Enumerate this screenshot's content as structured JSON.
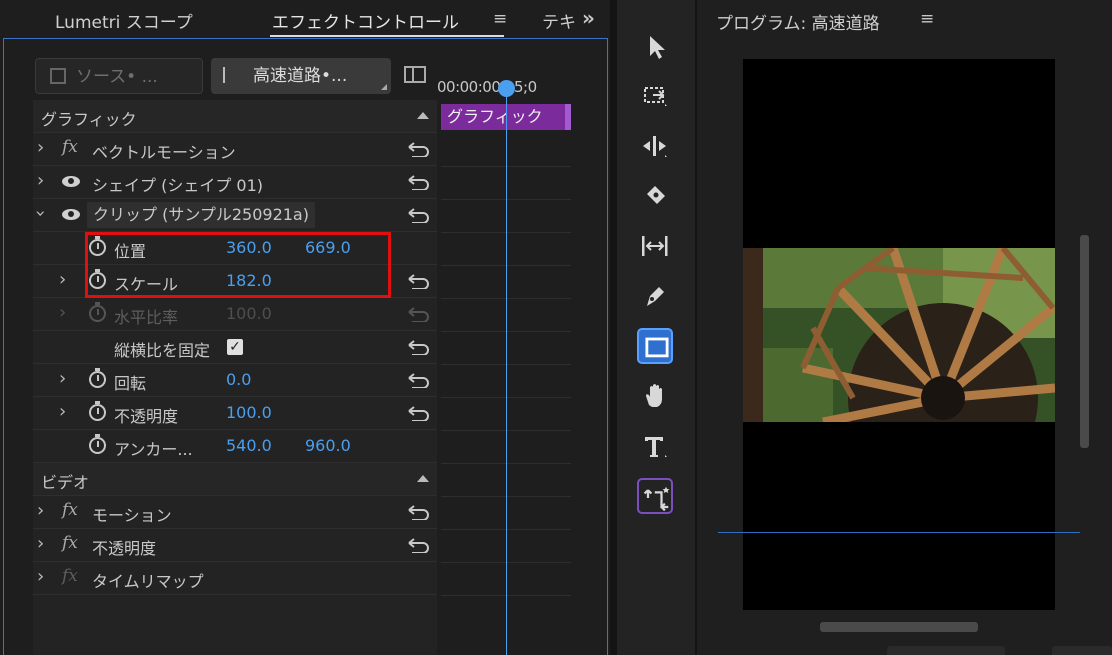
{
  "tabs": {
    "lumetri": "Lumetri スコープ",
    "effect_controls": "エフェクトコントロール",
    "menu": "≡",
    "text_truncated": "テキ",
    "more": "»"
  },
  "header": {
    "source_label": "ソース• ...",
    "clip_label": "高速道路•..."
  },
  "timeline": {
    "timecode": "00:00:00;05;0",
    "graphic_clip_label": "グラフィック"
  },
  "sections": {
    "graphic": "グラフィック",
    "video": "ビデオ"
  },
  "effects": {
    "vector_motion": "ベクトルモーション",
    "shape": "シェイプ (シェイプ 01)",
    "clip": "クリップ (サンプル250921a)",
    "motion": "モーション",
    "opacity_fx": "不透明度",
    "time_remap": "タイムリマップ"
  },
  "properties": {
    "position": {
      "label": "位置",
      "x": "360.0",
      "y": "669.0"
    },
    "scale": {
      "label": "スケール",
      "value": "182.0"
    },
    "h_ratio": {
      "label": "水平比率",
      "value": "100.0"
    },
    "lock_ratio": {
      "label": "縦横比を固定",
      "checked": true,
      "check": "✓"
    },
    "rotation": {
      "label": "回転",
      "value": "0.0"
    },
    "opacity": {
      "label": "不透明度",
      "value": "100.0"
    },
    "anchor": {
      "label": "アンカー...",
      "x": "540.0",
      "y": "960.0"
    }
  },
  "program": {
    "title": "プログラム: 高速道路",
    "menu": "≡"
  },
  "tools": [
    "selection-tool",
    "track-select-tool",
    "ripple-edit-tool",
    "razor-tool",
    "slip-tool",
    "pen-tool",
    "rectangle-tool",
    "hand-tool",
    "type-tool",
    "puppet-tool"
  ],
  "colors": {
    "accent_blue": "#4a9ff0",
    "clip_purple": "#7b2b9c",
    "highlight_red": "#e01010"
  }
}
